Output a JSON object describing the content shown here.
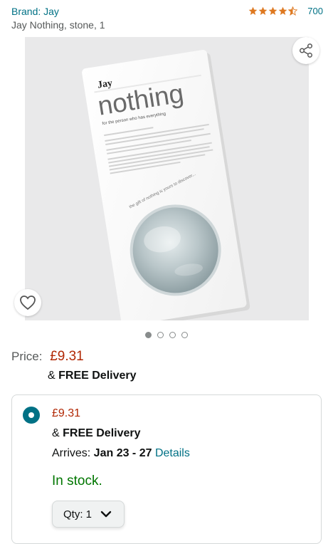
{
  "header": {
    "brand": "Brand: Jay",
    "rating_count": "700",
    "rating_stars": 4.5,
    "subtitle": "Jay Nothing, stone, 1"
  },
  "product_image": {
    "logo": "Jay",
    "brand_word": "nothing",
    "tagline": "for the person who has everything",
    "curve_text": "the gift of nothing is yours to discover..."
  },
  "carousel": {
    "total": 4,
    "active": 1
  },
  "icons": {
    "share": "share-icon",
    "wishlist": "heart-icon",
    "chevron": "chevron-down-icon"
  },
  "pricing": {
    "label": "Price:",
    "value": "£9.31",
    "delivery_prefix": "& ",
    "delivery_bold": "FREE Delivery"
  },
  "offer": {
    "price": "£9.31",
    "delivery_prefix": "& ",
    "delivery_bold": "FREE Delivery",
    "arrives_label": "Arrives: ",
    "arrives_date": "Jan 23 - 27",
    "details_link": "Details",
    "stock": "In stock.",
    "qty_label": "Qty: 1"
  },
  "colors": {
    "link": "#007185",
    "price": "#b12704",
    "stock": "#007600",
    "star": "#de7921"
  }
}
